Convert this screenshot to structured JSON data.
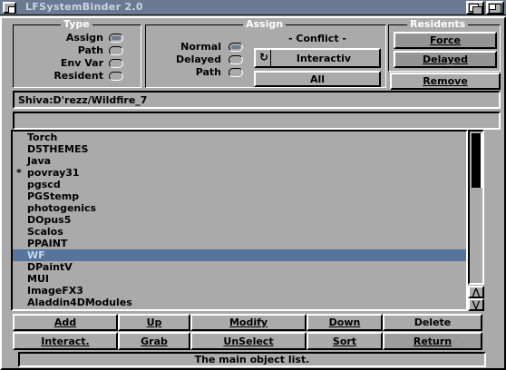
{
  "window": {
    "title": "LFSystemBinder 2.0"
  },
  "type_group": {
    "title": "Type",
    "options": [
      {
        "label": "Assign",
        "selected": true
      },
      {
        "label": "Path",
        "selected": false
      },
      {
        "label": "Env Var",
        "selected": false
      },
      {
        "label": "Resident",
        "selected": false
      }
    ]
  },
  "assign_group": {
    "title": "Assign",
    "options": [
      {
        "label": "Normal",
        "selected": true
      },
      {
        "label": "Delayed",
        "selected": false
      },
      {
        "label": "Path",
        "selected": false
      }
    ],
    "conflict_label": "- Conflict -",
    "conflict_cycle_value": "Interactiv",
    "all_button": "All"
  },
  "residents_group": {
    "title": "Residents",
    "force_button": "Force",
    "delayed_button": "Delayed",
    "remove_button": "Remove"
  },
  "path_field": {
    "value": "Shiva:D'rezz/Wildfire_7"
  },
  "second_field": {
    "value": ""
  },
  "list": {
    "items": [
      {
        "mark": "",
        "name": "Torch",
        "selected": false
      },
      {
        "mark": "",
        "name": "D5THEMES",
        "selected": false
      },
      {
        "mark": "",
        "name": "Java",
        "selected": false
      },
      {
        "mark": "*",
        "name": "povray31",
        "selected": false
      },
      {
        "mark": "",
        "name": "pgscd",
        "selected": false
      },
      {
        "mark": "",
        "name": "PGStemp",
        "selected": false
      },
      {
        "mark": "",
        "name": "photogenics",
        "selected": false
      },
      {
        "mark": "",
        "name": "DOpus5",
        "selected": false
      },
      {
        "mark": "",
        "name": "Scalos",
        "selected": false
      },
      {
        "mark": "",
        "name": "PPAINT",
        "selected": false
      },
      {
        "mark": "",
        "name": "WF",
        "selected": true
      },
      {
        "mark": "",
        "name": "DPaintV",
        "selected": false
      },
      {
        "mark": "",
        "name": "MUI",
        "selected": false
      },
      {
        "mark": "",
        "name": "ImageFX3",
        "selected": false
      },
      {
        "mark": "",
        "name": "Aladdin4DModules",
        "selected": false
      }
    ]
  },
  "buttons_row1": [
    "Add",
    "Up",
    "Modify",
    "Down",
    "Delete"
  ],
  "buttons_row2": [
    "Interact.",
    "Grab",
    "UnSelect",
    "Sort",
    "Return"
  ],
  "status": {
    "text": "The main object list."
  },
  "colors": {
    "titlebar": "#6a7a93",
    "background": "#aaaaaa",
    "selection": "#56759e"
  }
}
